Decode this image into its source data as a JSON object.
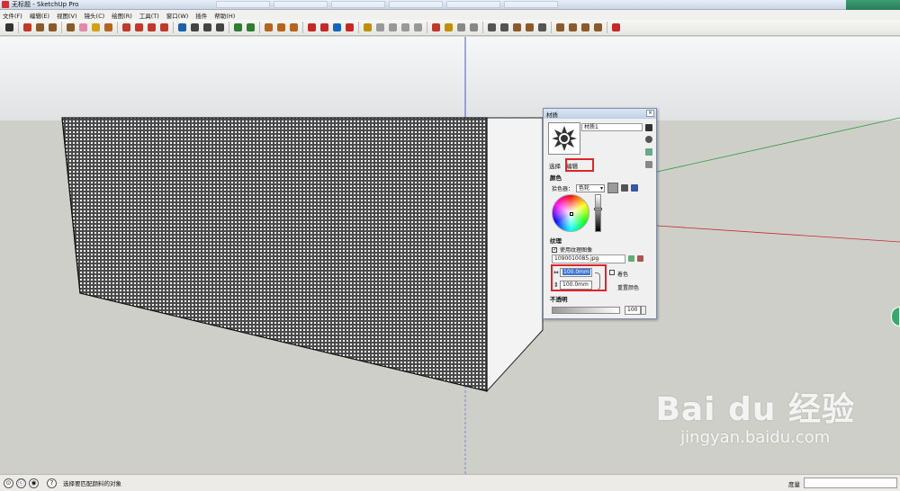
{
  "window": {
    "title": "无标题 - SketchUp Pro"
  },
  "menu": [
    "文件(F)",
    "编辑(E)",
    "视图(V)",
    "镜头(C)",
    "绘图(R)",
    "工具(T)",
    "窗口(W)",
    "插件",
    "帮助(H)"
  ],
  "toolbar": {
    "tools": [
      {
        "icon": "select-arrow-icon",
        "color": "#333333"
      },
      {
        "icon": "line-pencil-icon",
        "color": "#c0392b"
      },
      {
        "icon": "rectangle-icon",
        "color": "#8b5a2b"
      },
      {
        "icon": "circle-icon",
        "color": "#8b5a2b"
      },
      {
        "icon": "polygon-icon",
        "color": "#8b5a2b"
      },
      {
        "icon": "eraser-icon",
        "color": "#e48aa8"
      },
      {
        "icon": "tape-measure-icon",
        "color": "#d4a017"
      },
      {
        "icon": "paint-bucket-icon",
        "color": "#b5651d"
      },
      {
        "icon": "push-pull-icon",
        "color": "#c0392b"
      },
      {
        "icon": "move-icon",
        "color": "#c0392b"
      },
      {
        "icon": "rotate-icon",
        "color": "#c0392b"
      },
      {
        "icon": "offset-icon",
        "color": "#c0392b"
      },
      {
        "icon": "orbit-icon",
        "color": "#1f5fa8"
      },
      {
        "icon": "pan-icon",
        "color": "#444444"
      },
      {
        "icon": "zoom-icon",
        "color": "#444444"
      },
      {
        "icon": "zoom-extents-icon",
        "color": "#444444"
      },
      {
        "icon": "previous-view-icon",
        "color": "#2e7d32"
      },
      {
        "icon": "next-view-icon",
        "color": "#2e7d32"
      },
      {
        "icon": "iso-view-icon",
        "color": "#b5651d"
      },
      {
        "icon": "top-view-icon",
        "color": "#b5651d"
      },
      {
        "icon": "front-view-icon",
        "color": "#b5651d"
      },
      {
        "icon": "warehouse-icon",
        "color": "#c62828"
      },
      {
        "icon": "share-model-icon",
        "color": "#c62828"
      },
      {
        "icon": "components-icon",
        "color": "#1565c0"
      },
      {
        "icon": "extension-warehouse-icon",
        "color": "#c62828"
      },
      {
        "icon": "layer-icon",
        "color": "#c09000"
      },
      {
        "icon": "sandbox-icon",
        "color": "#999999"
      },
      {
        "icon": "position-camera-icon",
        "color": "#999999"
      },
      {
        "icon": "walk-icon",
        "color": "#999999"
      },
      {
        "icon": "look-around-icon",
        "color": "#999999"
      },
      {
        "icon": "section-plane-icon",
        "color": "#c0392b"
      },
      {
        "icon": "shadow-icon",
        "color": "#c09000"
      },
      {
        "icon": "fog-icon",
        "color": "#888888"
      },
      {
        "icon": "xray-icon",
        "color": "#888888"
      },
      {
        "icon": "wireframe-icon",
        "color": "#555555"
      },
      {
        "icon": "hidden-line-icon",
        "color": "#555555"
      },
      {
        "icon": "shaded-icon",
        "color": "#8b5a2b"
      },
      {
        "icon": "shaded-texture-icon",
        "color": "#8b5a2b"
      },
      {
        "icon": "monochrome-icon",
        "color": "#555555"
      },
      {
        "icon": "solid-union-icon",
        "color": "#8b5a2b"
      },
      {
        "icon": "solid-subtract-icon",
        "color": "#8b5a2b"
      },
      {
        "icon": "solid-trim-icon",
        "color": "#8b5a2b"
      },
      {
        "icon": "solid-split-icon",
        "color": "#8b5a2b"
      },
      {
        "icon": "help-icon",
        "color": "#c62828"
      }
    ]
  },
  "materials_panel": {
    "title": "材质",
    "material_name": "材质1",
    "tab_select": "选择",
    "tab_edit": "编辑",
    "color_section": "颜色",
    "picker_label": "拾色器：",
    "picker_value": "色轮",
    "texture_section": "纹理",
    "use_texture_label": "使用纹理图像",
    "texture_file": "1090010085.jpg",
    "width_value": "100.0mm",
    "height_value": "100.0mm",
    "colorize_label": "着色",
    "reset_color_label": "重置颜色",
    "opacity_section": "不透明",
    "opacity_value": "100"
  },
  "status": {
    "hint": "选择要匹配颜料的对象",
    "measure_label": "度量"
  },
  "watermark": {
    "main": "Bai du 经验",
    "url": "jingyan.baidu.com"
  }
}
